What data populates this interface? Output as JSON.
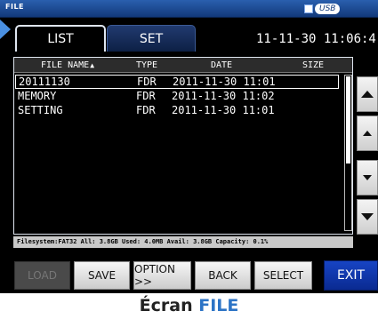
{
  "window": {
    "title": "FILE",
    "storage_label": "USB"
  },
  "tabs": [
    {
      "label": "LIST",
      "active": true
    },
    {
      "label": "SET",
      "active": false
    }
  ],
  "clock": "11-11-30 11:06:4",
  "table": {
    "columns": {
      "name": "FILE NAME",
      "type": "TYPE",
      "date": "DATE",
      "size": "SIZE"
    },
    "sort_indicator": "▲",
    "rows": [
      {
        "name": "20111130",
        "type": "FDR",
        "date": "2011-11-30 11:01",
        "selected": true
      },
      {
        "name": "MEMORY",
        "type": "FDR",
        "date": "2011-11-30 11:02",
        "selected": false
      },
      {
        "name": "SETTING",
        "type": "FDR",
        "date": "2011-11-30 11:01",
        "selected": false
      }
    ]
  },
  "status": "Filesystem:FAT32 All: 3.8GB Used: 4.0MB Avail: 3.8GB Capacity: 0.1%",
  "scroll_buttons": [
    "page-up",
    "line-up",
    "line-down",
    "page-down"
  ],
  "buttons": {
    "load": "LOAD",
    "save": "SAVE",
    "option": "OPTION >>",
    "back": "BACK",
    "select": "SELECT",
    "exit": "EXIT"
  },
  "caption": {
    "prefix": "Écran ",
    "accent": "FILE"
  },
  "colors": {
    "title_bar": "#12397a",
    "exit_button": "#0a2a91",
    "caption_accent": "#2d74c6",
    "pointer": "#4a90e2"
  }
}
